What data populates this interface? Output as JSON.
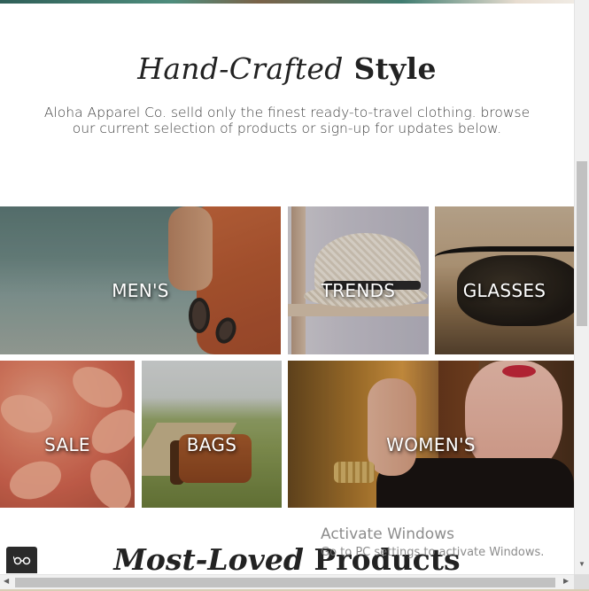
{
  "hero": {
    "title_italic": "Hand-Crafted",
    "title_bold": "Style",
    "subtitle": "Aloha Apparel Co. selld only the finest ready-to-travel clothing. browse our current selection of products or sign-up for updates below."
  },
  "categories": [
    {
      "label": "MEN'S"
    },
    {
      "label": "TRENDS"
    },
    {
      "label": "GLASSES"
    },
    {
      "label": "SALE"
    },
    {
      "label": "BAGS"
    },
    {
      "label": "WOMEN'S"
    }
  ],
  "next_section": {
    "title_italic": "Most-Loved",
    "title_bold": "Products"
  },
  "windows_watermark": {
    "line1": "Activate Windows",
    "line2": "Go to PC settings to activate Windows."
  },
  "chat_widget": {
    "icon": "glasses-icon"
  },
  "colors": {
    "heading": "#222222",
    "body_text": "#444444",
    "tile_label": "#ffffff"
  }
}
